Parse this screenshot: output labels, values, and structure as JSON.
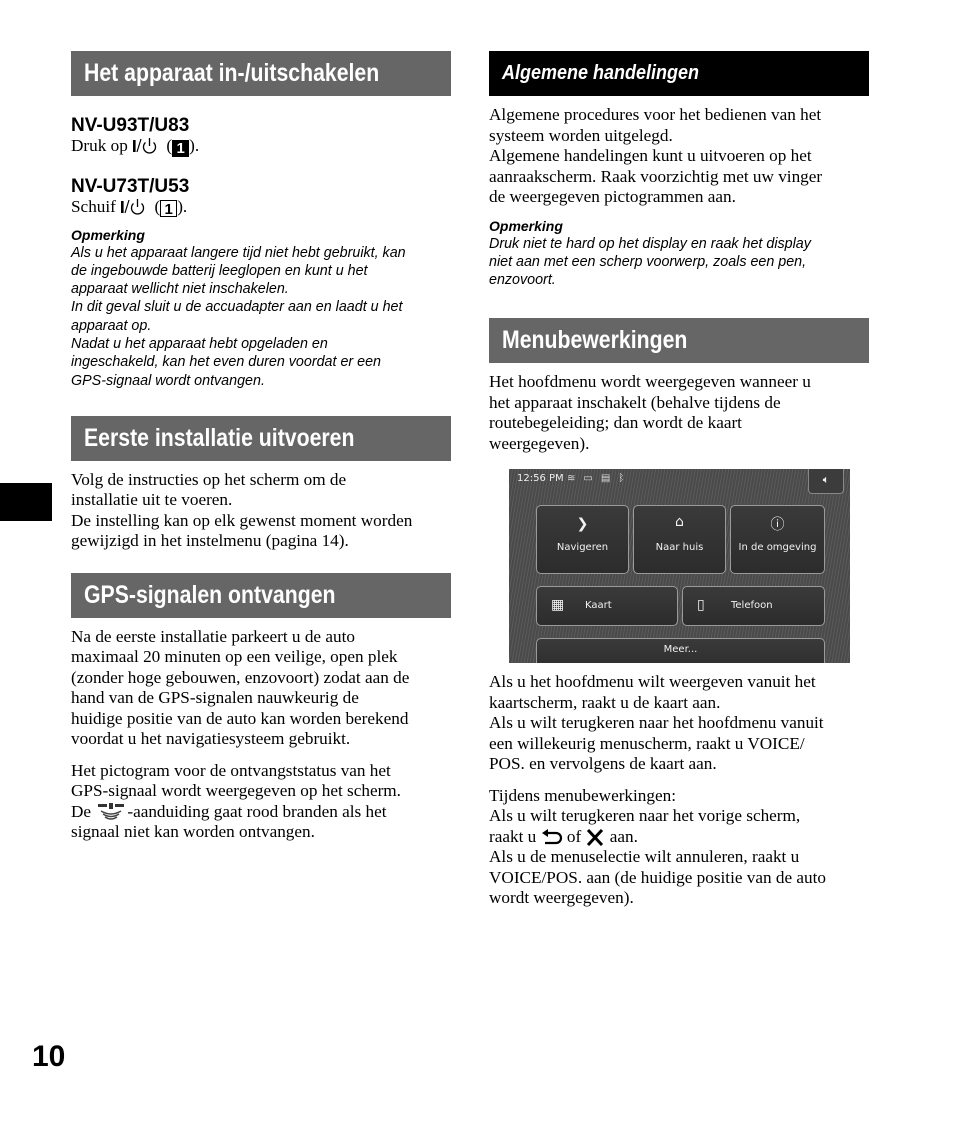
{
  "page_number": "10",
  "left_column": {
    "section1": {
      "title": "Het apparaat in-/uitschakelen",
      "models": [
        {
          "name": "NV-U93T/U83",
          "instruction_prefix": "Druk op",
          "key_label": "1",
          "key_style": "filled",
          "suffix": ")."
        },
        {
          "name": "NV-U73T/U53",
          "instruction_prefix": "Schuif",
          "key_label": "1",
          "key_style": "outline",
          "suffix": ")."
        }
      ],
      "note": {
        "title": "Opmerking",
        "lines": [
          "Als u het apparaat langere tijd niet hebt gebruikt, kan",
          "de ingebouwde batterij leeglopen en kunt u het",
          "apparaat wellicht niet inschakelen.",
          "In dit geval sluit u de accuadapter aan en laadt u het",
          "apparaat op.",
          "Nadat u het apparaat hebt opgeladen en",
          "ingeschakeld, kan het even duren voordat er een",
          "GPS-signaal wordt ontvangen."
        ]
      }
    },
    "section2": {
      "title": "Eerste installatie uitvoeren",
      "lines": [
        "Volg de instructies op het scherm om de",
        "installatie uit te voeren.",
        "De instelling kan op elk gewenst moment worden",
        "gewijzigd in het instelmenu (pagina 14)."
      ]
    },
    "section3": {
      "title": "GPS-signalen ontvangen",
      "para1": [
        "Na de eerste installatie parkeert u de auto",
        "maximaal 20 minuten op een veilige, open plek",
        "(zonder hoge gebouwen, enzovoort) zodat aan de",
        "hand van de GPS-signalen nauwkeurig de",
        "huidige positie van de auto kan worden berekend",
        "voordat u het navigatiesysteem gebruikt."
      ],
      "para2": [
        "Het pictogram voor de ontvangststatus van het",
        "GPS-signaal wordt weergegeven op het scherm."
      ],
      "para2_icon_prefix": "De",
      "para2_icon_suffix": "-aanduiding gaat rood branden als het",
      "para2_last": "signaal niet kan worden ontvangen."
    }
  },
  "right_column": {
    "section1": {
      "title": "Algemene handelingen",
      "lines": [
        "Algemene procedures voor het bedienen van het",
        "systeem worden uitgelegd.",
        "Algemene handelingen kunt u uitvoeren op het",
        "aanraakscherm. Raak voorzichtig met uw vinger",
        "de weergegeven pictogrammen aan."
      ],
      "note": {
        "title": "Opmerking",
        "lines": [
          "Druk niet te hard op het display en raak het display",
          "niet aan met een scherp voorwerp, zoals een pen,",
          "enzovoort."
        ]
      }
    },
    "section2": {
      "title": "Menubewerkingen",
      "intro": [
        "Het hoofdmenu wordt weergegeven wanneer u",
        "het apparaat inschakelt (behalve tijdens de",
        "routebegeleiding; dan wordt de kaart",
        "weergegeven)."
      ],
      "device_screen": {
        "time": "12:56 PM",
        "status_icons": [
          "gps-icon",
          "battery-icon",
          "traffic-icon",
          "bluetooth-icon"
        ],
        "buttons": {
          "navigate": "Navigeren",
          "home": "Naar huis",
          "nearby": "In de omgeving",
          "map": "Kaart",
          "phone": "Telefoon",
          "more": "Meer..."
        }
      },
      "para1": [
        "Als u het hoofdmenu wilt weergeven vanuit het",
        "kaartscherm, raakt u de kaart aan.",
        "Als u wilt terugkeren naar het hoofdmenu vanuit",
        "een willekeurig menuscherm, raakt u VOICE/",
        "POS. en vervolgens de kaart aan."
      ],
      "para2_line1": "Tijdens menubewerkingen:",
      "para2_line2": "Als u wilt terugkeren naar het vorige scherm,",
      "para2_raakt": "raakt u",
      "para2_of": "of",
      "para2_aan": "aan.",
      "para2_rest": [
        "Als u de menuselectie wilt annuleren, raakt u",
        "VOICE/POS. aan (de huidige positie van de auto",
        "wordt weergegeven)."
      ]
    }
  }
}
